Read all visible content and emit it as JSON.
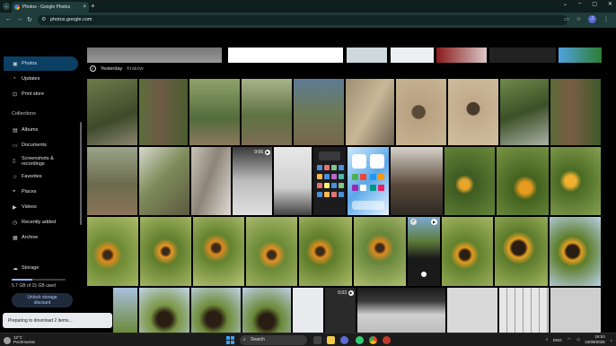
{
  "browser": {
    "tab_title": "Photos - Google Photos",
    "tab_close": "×",
    "new_tab": "+",
    "url": "photos.google.com",
    "profile_initial": "J",
    "window_controls": [
      "⌄",
      "–",
      "▢",
      "✕"
    ]
  },
  "sidebar": {
    "items": [
      {
        "label": "Photos",
        "icon": "photo-icon",
        "glyph": "▣",
        "active": true
      },
      {
        "label": "Updates",
        "icon": "bell-icon",
        "glyph": "🔔"
      },
      {
        "label": "Print store",
        "icon": "cart-icon",
        "glyph": "🛒"
      }
    ],
    "collections_heading": "Collections",
    "collections": [
      {
        "label": "Albums",
        "icon": "album-icon",
        "glyph": "▤"
      },
      {
        "label": "Documents",
        "icon": "document-icon",
        "glyph": "▭"
      },
      {
        "label": "Screenshots &\nrecordings",
        "icon": "screenshot-icon",
        "glyph": "▯"
      },
      {
        "label": "Favorites",
        "icon": "star-icon",
        "glyph": "☆"
      },
      {
        "label": "Places",
        "icon": "pin-icon",
        "glyph": "⌖"
      },
      {
        "label": "Videos",
        "icon": "video-icon",
        "glyph": "▶"
      },
      {
        "label": "Recently added",
        "icon": "clock-icon",
        "glyph": "◷"
      },
      {
        "label": "Archive",
        "icon": "archive-icon",
        "glyph": "▦"
      }
    ],
    "storage_label": "Storage",
    "storage_used": "5.7 GB of 15 GB used",
    "storage_fraction": 0.38,
    "unlock_button": "Unlock storage\ndiscount"
  },
  "main": {
    "date_label": "Yesterday",
    "location": "Kraków",
    "video_durations": [
      "0:06",
      "0:03"
    ]
  },
  "toast": "Preparing to download 2 items...",
  "taskbar": {
    "temperature": "12°C",
    "weather_desc": "Pochmurnie",
    "search_placeholder": "Search",
    "language": "ENG",
    "time": "18:53",
    "date": "23/09/2025"
  },
  "colors": {
    "accent": "#0b3f63",
    "chrome": "#1f3b3a",
    "background": "#000000"
  }
}
